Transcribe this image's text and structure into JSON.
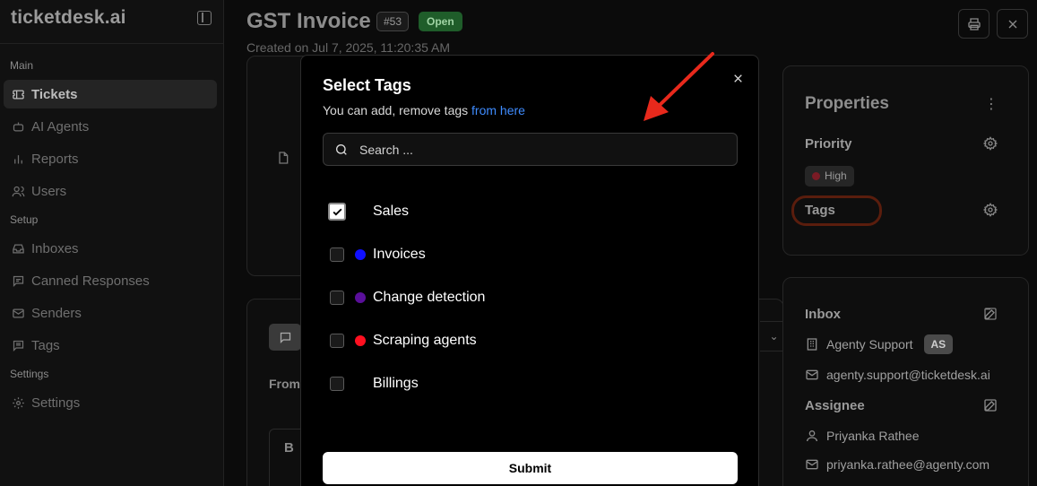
{
  "app": {
    "brand": "ticketdesk.ai"
  },
  "sidebar": {
    "sections": [
      {
        "label": "Main"
      },
      {
        "label": "Setup"
      },
      {
        "label": "Settings"
      }
    ],
    "items": [
      {
        "label": "Tickets",
        "icon": "ticket-icon",
        "active": true
      },
      {
        "label": "AI Agents",
        "icon": "bot-icon"
      },
      {
        "label": "Reports",
        "icon": "bar-chart-icon"
      },
      {
        "label": "Users",
        "icon": "users-icon"
      },
      {
        "label": "Inboxes",
        "icon": "inbox-icon"
      },
      {
        "label": "Canned Responses",
        "icon": "message-icon"
      },
      {
        "label": "Senders",
        "icon": "mail-icon"
      },
      {
        "label": "Tags",
        "icon": "tag-message-icon"
      },
      {
        "label": "Settings",
        "icon": "gear-icon"
      }
    ]
  },
  "ticket": {
    "title": "GST Invoice",
    "number": "#53",
    "status": "Open",
    "created": "Created on Jul 7, 2025, 11:20:35 AM"
  },
  "composer": {
    "from_label": "From",
    "bold_label": "B"
  },
  "properties": {
    "title": "Properties",
    "priority_label": "Priority",
    "priority_value": "High",
    "priority_color": "#7a1b25",
    "tags_label": "Tags"
  },
  "details": {
    "inbox_label": "Inbox",
    "inbox_name": "Agenty Support",
    "inbox_badge": "AS",
    "inbox_email": "agenty.support@ticketdesk.ai",
    "assignee_label": "Assignee",
    "assignee_name": "Priyanka Rathee",
    "assignee_email": "priyanka.rathee@agenty.com"
  },
  "modal": {
    "title": "Select Tags",
    "subtitle_text": "You can add, remove tags ",
    "subtitle_link": "from here",
    "search_placeholder": "Search ...",
    "tags": [
      {
        "label": "Sales",
        "checked": true,
        "color": ""
      },
      {
        "label": "Invoices",
        "checked": false,
        "color": "#1010ff"
      },
      {
        "label": "Change detection",
        "checked": false,
        "color": "#5a0f9a"
      },
      {
        "label": "Scraping agents",
        "checked": false,
        "color": "#ff1020"
      },
      {
        "label": "Billings",
        "checked": false,
        "color": ""
      }
    ],
    "submit_label": "Submit"
  },
  "annotation": {
    "arrow_color": "#e8291c"
  }
}
